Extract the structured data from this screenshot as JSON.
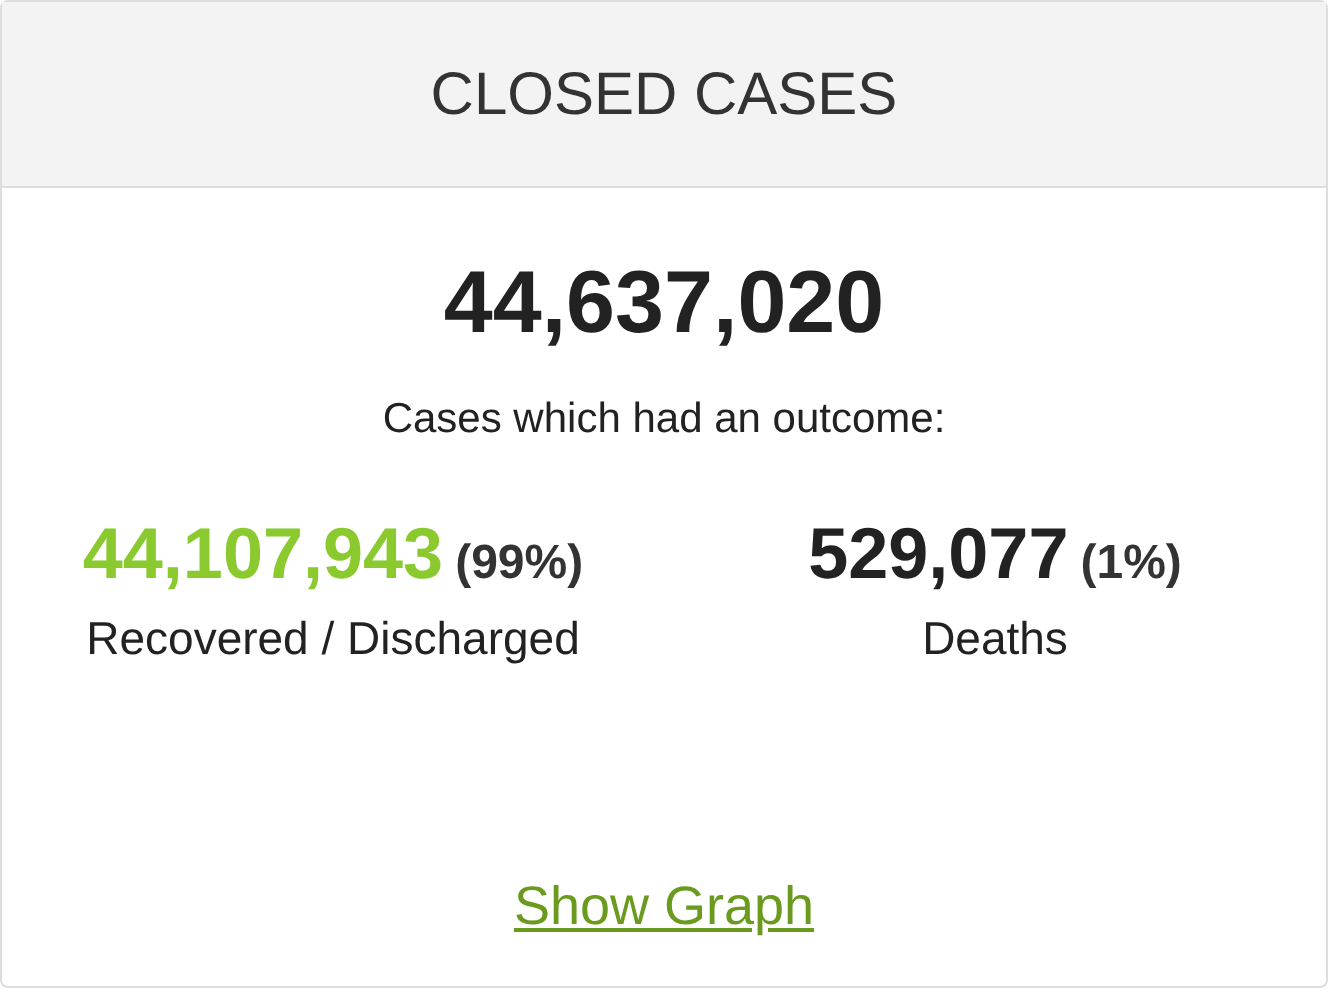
{
  "header": {
    "title": "CLOSED CASES"
  },
  "total": "44,637,020",
  "subtitle": "Cases which had an outcome:",
  "outcomes": [
    {
      "value": "44,107,943",
      "percent": "(99%)",
      "label": "Recovered / Discharged",
      "color": "#8aca2f"
    },
    {
      "value": "529,077",
      "percent": "(1%)",
      "label": "Deaths",
      "color": "#222222"
    }
  ],
  "link": "Show Graph"
}
